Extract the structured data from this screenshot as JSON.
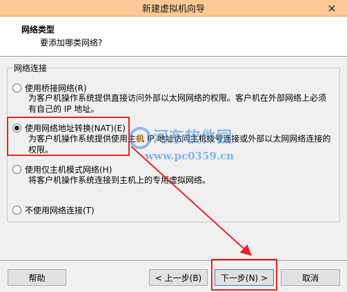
{
  "window": {
    "title": "新建虚拟机向导",
    "close_glyph": "✕"
  },
  "header": {
    "title": "网络类型",
    "subtitle": "要添加哪类网络?"
  },
  "group": {
    "label": "网络连接"
  },
  "options": [
    {
      "label": "使用桥接网络(R)",
      "desc": "为客户机操作系统提供直接访问外部以太网网络的权限。客户机在外部网络上必须有自己的 IP 地址。",
      "checked": false
    },
    {
      "label": "使用网络地址转换(NAT)(E)",
      "desc": "为客户机操作系统提供使用主机 IP 地址访问主机拨号连接或外部以太网网络连接的权限。",
      "checked": true
    },
    {
      "label": "使用仅主机模式网络(H)",
      "desc": "将客户机操作系统连接到主机上的专用虚拟网络。",
      "checked": false
    },
    {
      "label": "不使用网络连接(T)",
      "desc": "",
      "checked": false
    }
  ],
  "buttons": {
    "help": "帮助",
    "back": "< 上一步(B)",
    "next": "下一步(N) >",
    "cancel": "取消"
  },
  "watermark": {
    "text": "河东软件园",
    "url": "www.pc0359.cn"
  },
  "colors": {
    "highlight": "#e8232a",
    "titlebar": "#fbc997"
  }
}
